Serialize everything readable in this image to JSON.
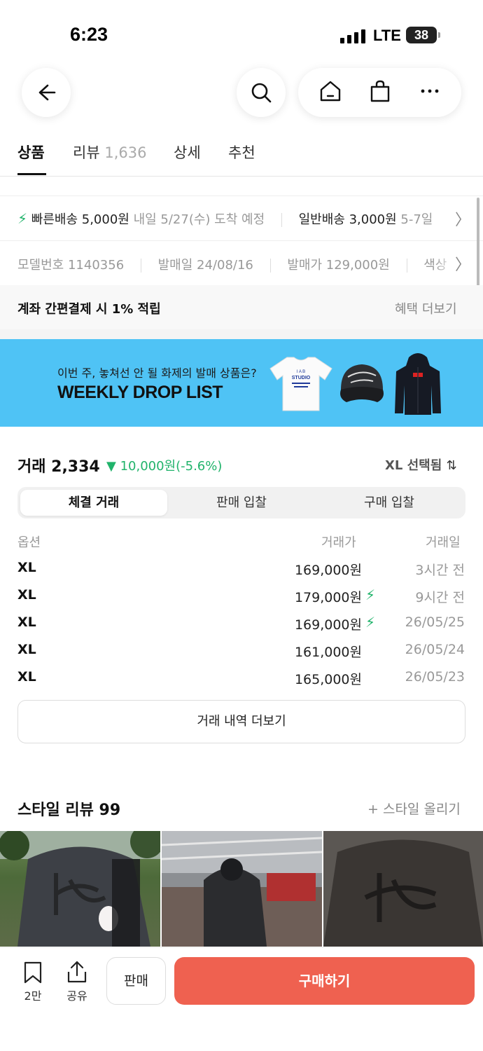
{
  "status_bar": {
    "time": "6:23",
    "network": "LTE",
    "battery": "38"
  },
  "tabs": [
    {
      "label": "상품"
    },
    {
      "label": "리뷰",
      "count": "1,636"
    },
    {
      "label": "상세"
    },
    {
      "label": "추천"
    }
  ],
  "shipping": {
    "fast_label": "빠른배송 5,000원",
    "fast_eta": "내일 5/27(수) 도착 예정",
    "normal_label": "일반배송 3,000원",
    "normal_eta": "5-7일"
  },
  "info": {
    "model_label": "모델번호",
    "model_value": "1140356",
    "release_label": "발매일",
    "release_value": "24/08/16",
    "price_label": "발매가",
    "price_value": "129,000원",
    "color_label": "색상"
  },
  "benefit": {
    "text": "계좌 간편결제 시 1% 적립",
    "more": "혜택 더보기"
  },
  "banner": {
    "subtitle": "이번 주, 놓쳐선 안 될 화제의 발매 상품은?",
    "title": "WEEKLY DROP LIST",
    "tee_text_1": "I A B",
    "tee_text_2": "STUDIO",
    "accent_color": "#4fc3f5"
  },
  "trade": {
    "title": "거래 2,334",
    "change_arrow": "▼",
    "change": "10,000원(-5.6%)",
    "option_selected": "XL 선택됨",
    "segments": [
      "체결 거래",
      "판매 입찰",
      "구매 입찰"
    ],
    "columns": [
      "옵션",
      "거래가",
      "거래일"
    ],
    "rows": [
      {
        "option": "XL",
        "price": "169,000원",
        "fast": false,
        "date": "3시간 전"
      },
      {
        "option": "XL",
        "price": "179,000원",
        "fast": true,
        "date": "9시간 전"
      },
      {
        "option": "XL",
        "price": "169,000원",
        "fast": true,
        "date": "26/05/25"
      },
      {
        "option": "XL",
        "price": "161,000원",
        "fast": false,
        "date": "26/05/24"
      },
      {
        "option": "XL",
        "price": "165,000원",
        "fast": false,
        "date": "26/05/23"
      }
    ],
    "more_label": "거래 내역 더보기",
    "accent_green": "#21b36b"
  },
  "style_review": {
    "title": "스타일 리뷰 99",
    "upload": "+ 스타일 올리기"
  },
  "bottom_bar": {
    "wish_label": "2만",
    "share_label": "공유",
    "sell_label": "판매",
    "buy_label": "구매하기",
    "buy_color": "#ef6150"
  }
}
